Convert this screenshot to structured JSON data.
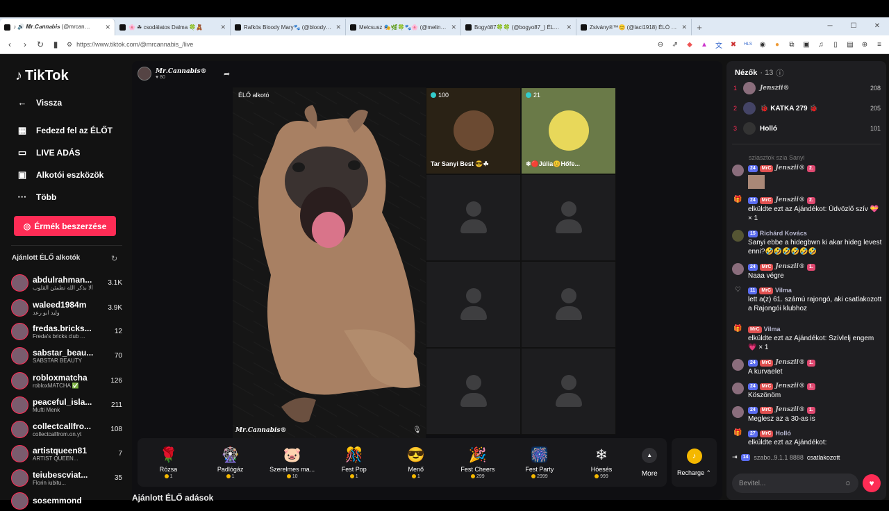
{
  "browser": {
    "tabs": [
      {
        "title": "♪ 🔊 𝑴𝒓.𝑪𝒂𝒏𝒏𝒂𝒃𝒊𝒔 (@mrcan…",
        "active": true
      },
      {
        "title": "🌸 ☘ csodálatos Dalma 🍀🧸",
        "active": false
      },
      {
        "title": "Rafkós Bloody Mary🐾 (@bloodyma…",
        "active": false
      },
      {
        "title": "Melcsusz 🎭🌿🍀🐾🌸 (@melin…",
        "active": false
      },
      {
        "title": "Bogyó87🍀🍀 (@bogyo87_) ÉLŐ a…",
        "active": false
      },
      {
        "title": "Zsivány®™😊 (@laci1918) ÉLŐ adá…",
        "active": false
      }
    ],
    "new_tab": "+",
    "url": "https://www.tiktok.com/@mrcannabis_/live"
  },
  "sidebar": {
    "logo": "TikTok",
    "nav": [
      {
        "label": "Vissza",
        "icon": "arrow-left-icon"
      },
      {
        "label": "Fedezd fel az ÉLŐT",
        "icon": "calendar-icon"
      },
      {
        "label": "LIVE ADÁS",
        "icon": "camera-icon"
      },
      {
        "label": "Alkotói eszközök",
        "icon": "tools-icon"
      },
      {
        "label": "Több",
        "icon": "more-icon"
      }
    ],
    "coins_button": "Érmék beszerzése",
    "suggested_title": "Ajánlott ÉLŐ alkotók",
    "creators": [
      {
        "name": "abdulrahman...",
        "sub": "ألا بذكر الله تطمئن القلوب",
        "count": "3.1K"
      },
      {
        "name": "waleed1984m",
        "sub": "وليد ابو رعد",
        "count": "3.9K"
      },
      {
        "name": "fredas.bricks...",
        "sub": "Freda's bricks club ...",
        "count": "12"
      },
      {
        "name": "sabstar_beau...",
        "sub": "SABSTAR BEAUTY",
        "count": "70"
      },
      {
        "name": "robloxmatcha",
        "sub": "robloxMATCHA ✅",
        "count": "126"
      },
      {
        "name": "peaceful_isla...",
        "sub": "Mufti Menk",
        "count": "211"
      },
      {
        "name": "collectcallfro...",
        "sub": "collectcallfrom.on.yt",
        "count": "108"
      },
      {
        "name": "artistqueen81",
        "sub": "ARTIST QUEEN...",
        "count": "7"
      },
      {
        "name": "teiubescviat...",
        "sub": "Florin iubitu...",
        "count": "35"
      },
      {
        "name": "sosemmond",
        "sub": "",
        "count": ""
      }
    ]
  },
  "stream": {
    "host_name": "𝑴𝒓.𝑪𝒂𝒏𝒏𝒂𝒃𝒊𝒔®",
    "host_likes": "80",
    "stage_label": "ÉLŐ alkotó",
    "stage_watermark": "𝑴𝒓.𝑪𝒂𝒏𝒏𝒂𝒃𝒊𝒔®",
    "guests": [
      {
        "count": "100",
        "name": "Tar Sanyi Best 😎☘"
      },
      {
        "count": "21",
        "name": "❄🔴Júlia😊Hőfe..."
      }
    ]
  },
  "gifts": [
    {
      "name": "Rózsa",
      "price": "1",
      "icon": "🌹"
    },
    {
      "name": "Padlógáz",
      "price": "1",
      "icon": "🎡"
    },
    {
      "name": "Szerelmes ma...",
      "price": "10",
      "icon": "🐷"
    },
    {
      "name": "Fest Pop",
      "price": "1",
      "icon": "🎊"
    },
    {
      "name": "Menő",
      "price": "1",
      "icon": "😎"
    },
    {
      "name": "Fest Cheers",
      "price": "299",
      "icon": "🎉"
    },
    {
      "name": "Fest Party",
      "price": "2999",
      "icon": "🎆"
    },
    {
      "name": "Hóesés",
      "price": "999",
      "icon": "❄"
    }
  ],
  "more_label": "More",
  "recharge_label": "Recharge ⌃",
  "recommend_heading": "Ajánlott ÉLŐ adások",
  "chat": {
    "viewers_title": "Nézők",
    "viewers_count": "· 13",
    "top_viewers": [
      {
        "rank": "1",
        "name": "𝑱𝒆𝒏𝒔𝒛𝒊𝒊®",
        "points": "208"
      },
      {
        "rank": "2",
        "name": "🐞 KATKA 279 🐞",
        "points": "205"
      },
      {
        "rank": "3",
        "name": "Holló",
        "points": "101"
      }
    ],
    "faded": "sziasztok szia Sanyi",
    "messages": [
      {
        "user": "𝑱𝒆𝒏𝒔𝒛𝒊𝒊®",
        "lvl": "24",
        "text": ""
      },
      {
        "user": "𝑱𝒆𝒏𝒔𝒛𝒊𝒊®",
        "lvl": "24",
        "text": "elküldte ezt az Ajándékot: Üdvözlő szív 💝 × 1"
      },
      {
        "user": "Richárd Kovács",
        "lvl": "15",
        "text": "Sanyi ebbe a hidegbwn ki akar hideg levest enni?🤣🤣🤣🤣🤣🤣"
      },
      {
        "user": "𝑱𝒆𝒏𝒔𝒛𝒊𝒊®",
        "lvl": "24",
        "text": "Naaa végre"
      },
      {
        "user": "Vilma",
        "lvl": "11",
        "text": "lett a(z) 61. számú rajongó, aki csatlakozott a Rajongói klubhoz"
      },
      {
        "user": "Vilma",
        "lvl": "",
        "text": "elküldte ezt az Ajándékot: Szívlelj engem 💗 × 1"
      },
      {
        "user": "𝑱𝒆𝒏𝒔𝒛𝒊𝒊®",
        "lvl": "24",
        "text": "A kurvaelet"
      },
      {
        "user": "𝑱𝒆𝒏𝒔𝒛𝒊𝒊®",
        "lvl": "24",
        "text": "Köszönöm"
      },
      {
        "user": "𝑱𝒆𝒏𝒔𝒛𝒊𝒊®",
        "lvl": "24",
        "text": "Meglesz az a 30-as is"
      },
      {
        "user": "Holló",
        "lvl": "27",
        "text": "elküldte ezt az Ajándékot:"
      }
    ],
    "joined_lvl": "14",
    "joined_user": "szabo..9.1.1 8888",
    "joined_text": "csatlakozott",
    "input_placeholder": "Bevitel..."
  }
}
